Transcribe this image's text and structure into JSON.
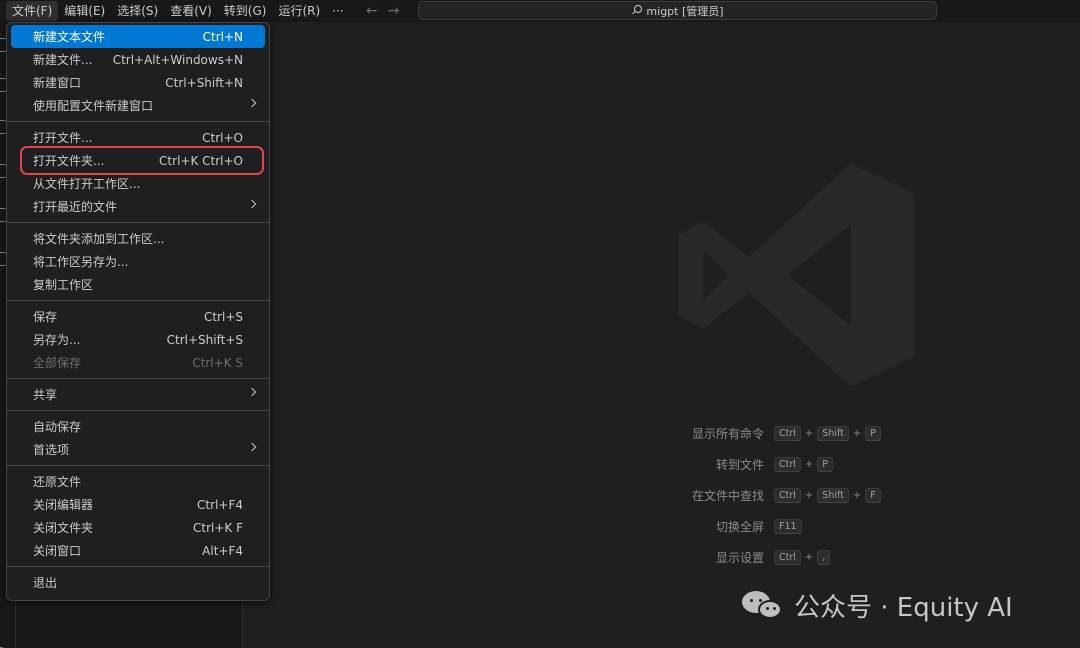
{
  "menubar": {
    "items": [
      "文件(F)",
      "编辑(E)",
      "选择(S)",
      "查看(V)",
      "转到(G)",
      "运行(R)",
      "···"
    ]
  },
  "nav": {
    "back": "←",
    "forward": "→"
  },
  "command_center": {
    "label": "migpt [管理员]",
    "icon": "search-icon"
  },
  "file_menu": {
    "groups": [
      [
        {
          "label": "新建文本文件",
          "shortcut": "Ctrl+N",
          "highlighted": true
        },
        {
          "label": "新建文件...",
          "shortcut": "Ctrl+Alt+Windows+N"
        },
        {
          "label": "新建窗口",
          "shortcut": "Ctrl+Shift+N"
        },
        {
          "label": "使用配置文件新建窗口",
          "shortcut": "",
          "submenu": true
        }
      ],
      [
        {
          "label": "打开文件...",
          "shortcut": "Ctrl+O"
        },
        {
          "label": "打开文件夹...",
          "shortcut": "Ctrl+K Ctrl+O",
          "boxed": true
        },
        {
          "label": "从文件打开工作区...",
          "shortcut": ""
        },
        {
          "label": "打开最近的文件",
          "shortcut": "",
          "submenu": true
        }
      ],
      [
        {
          "label": "将文件夹添加到工作区...",
          "shortcut": ""
        },
        {
          "label": "将工作区另存为...",
          "shortcut": ""
        },
        {
          "label": "复制工作区",
          "shortcut": ""
        }
      ],
      [
        {
          "label": "保存",
          "shortcut": "Ctrl+S"
        },
        {
          "label": "另存为...",
          "shortcut": "Ctrl+Shift+S"
        },
        {
          "label": "全部保存",
          "shortcut": "Ctrl+K S",
          "disabled": true
        }
      ],
      [
        {
          "label": "共享",
          "shortcut": "",
          "submenu": true
        }
      ],
      [
        {
          "label": "自动保存",
          "shortcut": ""
        },
        {
          "label": "首选项",
          "shortcut": "",
          "submenu": true
        }
      ],
      [
        {
          "label": "还原文件",
          "shortcut": ""
        },
        {
          "label": "关闭编辑器",
          "shortcut": "Ctrl+F4"
        },
        {
          "label": "关闭文件夹",
          "shortcut": "Ctrl+K F"
        },
        {
          "label": "关闭窗口",
          "shortcut": "Alt+F4"
        }
      ],
      [
        {
          "label": "退出",
          "shortcut": ""
        }
      ]
    ]
  },
  "shortcuts": [
    {
      "label": "显示所有命令",
      "keys": [
        "Ctrl",
        "Shift",
        "P"
      ]
    },
    {
      "label": "转到文件",
      "keys": [
        "Ctrl",
        "P"
      ]
    },
    {
      "label": "在文件中查找",
      "keys": [
        "Ctrl",
        "Shift",
        "F"
      ]
    },
    {
      "label": "切换全屏",
      "keys": [
        "F11"
      ]
    },
    {
      "label": "显示设置",
      "keys": [
        "Ctrl",
        ","
      ]
    }
  ],
  "watermark": {
    "text": "公众号 · Equity AI",
    "icon": "wechat-icon"
  },
  "colors": {
    "highlight": "#0078d4",
    "callout_box": "#e04545",
    "background": "#1f1f1f"
  }
}
